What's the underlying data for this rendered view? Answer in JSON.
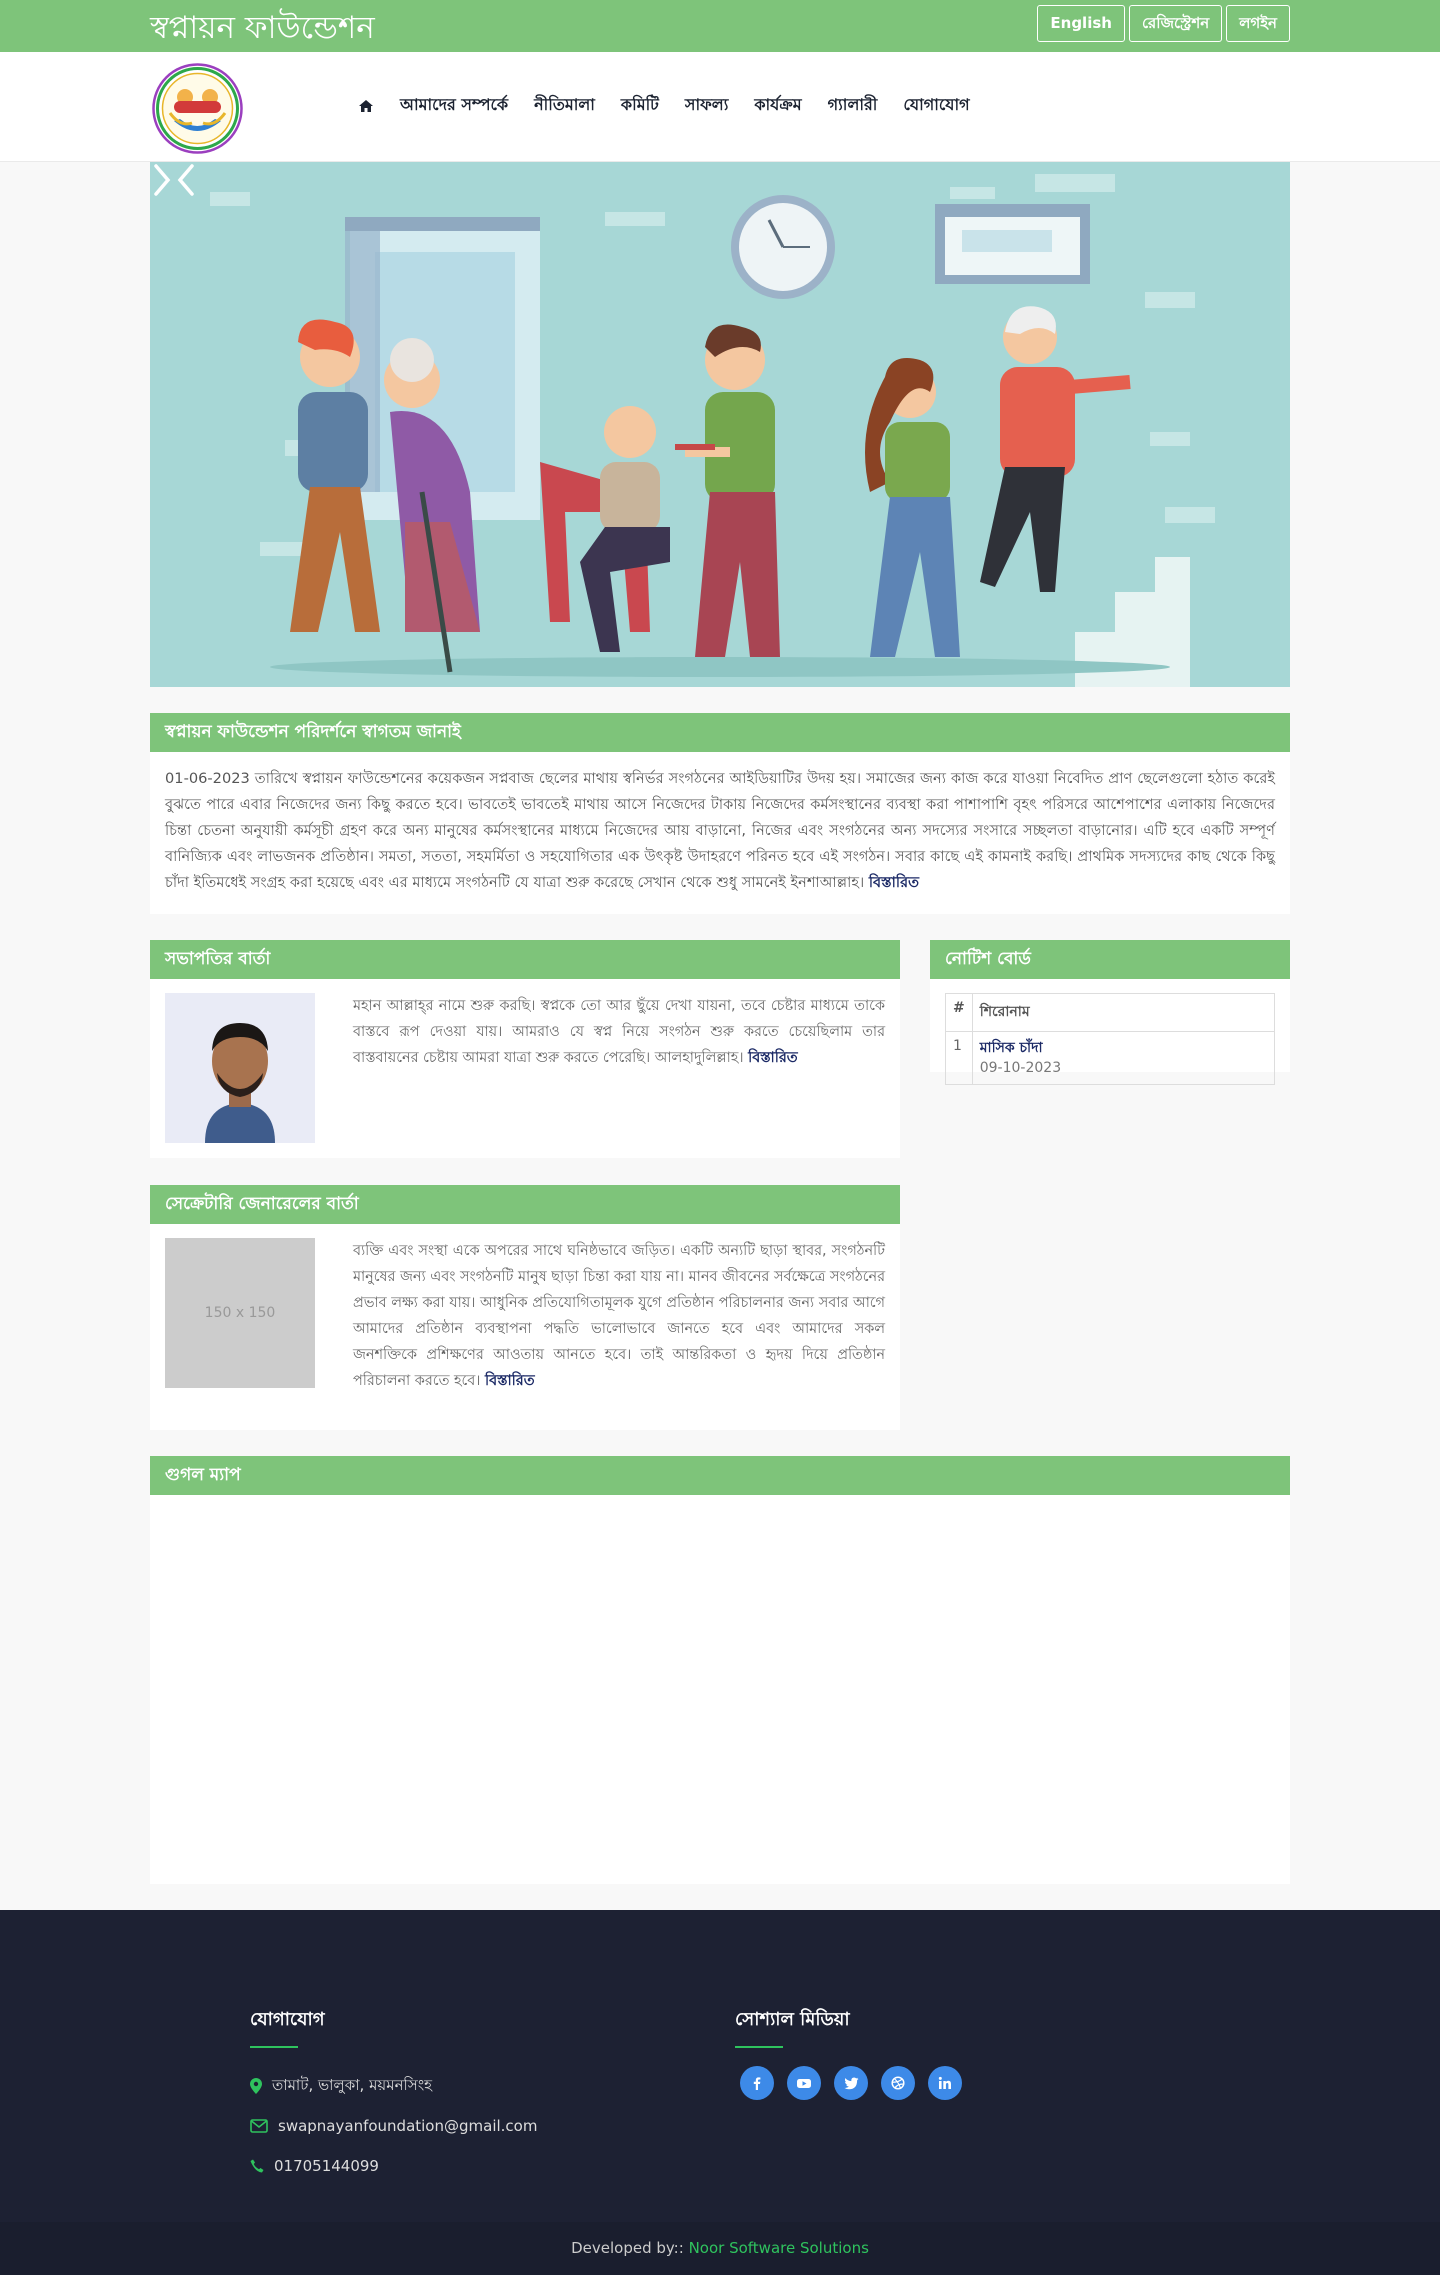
{
  "header": {
    "site_title": "স্বপ্নায়ন ফাউন্ডেশন",
    "buttons": [
      "English",
      "রেজিস্ট্রেশন",
      "লগইন"
    ]
  },
  "nav": {
    "home_icon": "home-icon",
    "items": [
      "আমাদের সম্পর্কে",
      "নীতিমালা",
      "কমিটি",
      "সাফল্য",
      "কার্যক্রম",
      "গ্যালারী",
      "যোগাযোগ"
    ]
  },
  "slider": {
    "prev_icon": "chevron-left-icon",
    "next_icon": "chevron-right-icon"
  },
  "welcome": {
    "title": "স্বপ্নায়ন ফাউন্ডেশন পরিদর্শনে স্বাগতম জানাই",
    "text": "01-06-2023 তারিখে স্বপ্নায়ন ফাউন্ডেশনের কয়েকজন সপ্নবাজ ছেলের মাথায় স্বনির্ভর সংগঠনের আইডিয়াটির উদয় হয়। সমাজের জন্য কাজ করে যাওয়া নিবেদিত প্রাণ ছেলেগুলো হঠাত করেই বুঝতে পারে এবার নিজেদের জন্য কিছু করতে হবে। ভাবতেই ভাবতেই মাথায় আসে নিজেদের টাকায় নিজেদের কর্মসংস্থানের ব্যবস্থা করা পাশাপাশি বৃহৎ পরিসরে আশেপাশের এলাকায় নিজেদের চিন্তা চেতনা অনুযায়ী কর্মসূচী গ্রহণ করে অন্য মানুষের কর্মসংস্থানের মাধ্যমে নিজেদের আয় বাড়ানো, নিজের এবং সংগঠনের অন্য সদস্যের সংসারে সচ্ছলতা বাড়ানোর। এটি হবে একটি সম্পূর্ণ বানিজ্যিক এবং লাভজনক প্রতিষ্ঠান। সমতা, সততা, সহমর্মিতা ও সহযোগিতার এক উৎকৃষ্ট উদাহরণে পরিনত হবে এই সংগঠন। সবার কাছে এই কামনাই করছি। প্রাথমিক সদস্যদের কাছ থেকে কিছু চাঁদা ইতিমধেই সংগ্রহ করা হয়েছে এবং এর মাধ্যমে সংগঠনটি যে যাত্রা শুরু করেছে সেখান থেকে শুধু সামনেই ইনশাআল্লাহ।",
    "more": "বিস্তারিত"
  },
  "president": {
    "title": "সভাপতির বার্তা",
    "text": "মহান আল্লাহ্‌র নামে শুরু করছি। স্বপ্নকে তো আর ছুঁয়ে দেখা যায়না, তবে চেষ্টার মাধ্যমে তাকে বাস্তবে রূপ দেওয়া যায়। আমরাও যে স্বপ্ন নিয়ে সংগঠন শুরু করতে চেয়েছিলাম তার বাস্তবায়নের চেষ্টায় আমরা যাত্রা শুরু করতে পেরেছি। আলহাদুলিল্লাহ।",
    "more": "বিস্তারিত"
  },
  "secretary": {
    "title": "সেক্রেটারি জেনারেলের বার্তা",
    "placeholder": "150 x 150",
    "text": "ব্যক্তি এবং সংস্থা একে অপরের সাথে ঘনিষ্ঠভাবে জড়িত। একটি অন্যটি ছাড়া স্থাবর, সংগঠনটি মানুষের জন্য এবং সংগঠনটি মানুষ ছাড়া চিন্তা করা যায় না। মানব জীবনের সর্বক্ষেত্রে সংগঠনের প্রভাব লক্ষ্য করা যায়। আধুনিক প্রতিযোগিতামূলক যুগে প্রতিষ্ঠান পরিচালনার জন্য সবার আগে আমাদের প্রতিষ্ঠান ব্যবস্থাপনা পদ্ধতি ভালোভাবে জানতে হবে এবং আমাদের সকল জনশক্তিকে প্রশিক্ষণের আওতায় আনতে হবে। তাই আন্তরিকতা ও হৃদয় দিয়ে প্রতিষ্ঠান পরিচালনা করতে হবে।",
    "more": "বিস্তারিত"
  },
  "notice": {
    "title": "নোটিশ বোর্ড",
    "headers": [
      "#",
      "শিরোনাম"
    ],
    "rows": [
      {
        "num": "1",
        "title": "মাসিক চাঁদা",
        "date": "09-10-2023"
      }
    ]
  },
  "map": {
    "title": "গুগল ম্যাপ"
  },
  "footer": {
    "contact_title": "যোগাযোগ",
    "address": "তামাট, ভালুকা, ময়মনসিংহ",
    "email": "swapnayanfoundation@gmail.com",
    "phone": "01705144099",
    "social_title": "সোশ্যাল মিডিয়া",
    "social_icons": [
      "facebook-icon",
      "youtube-icon",
      "twitter-icon",
      "dribbble-icon",
      "linkedin-icon"
    ],
    "credit_prefix": "Developed by:: ",
    "credit_name": "Noor Software Solutions"
  },
  "colors": {
    "accent_green": "#7ec47a",
    "footer_bg": "#1d2133",
    "link_blue": "#1c2a66",
    "social_blue": "#3d8ae8"
  }
}
